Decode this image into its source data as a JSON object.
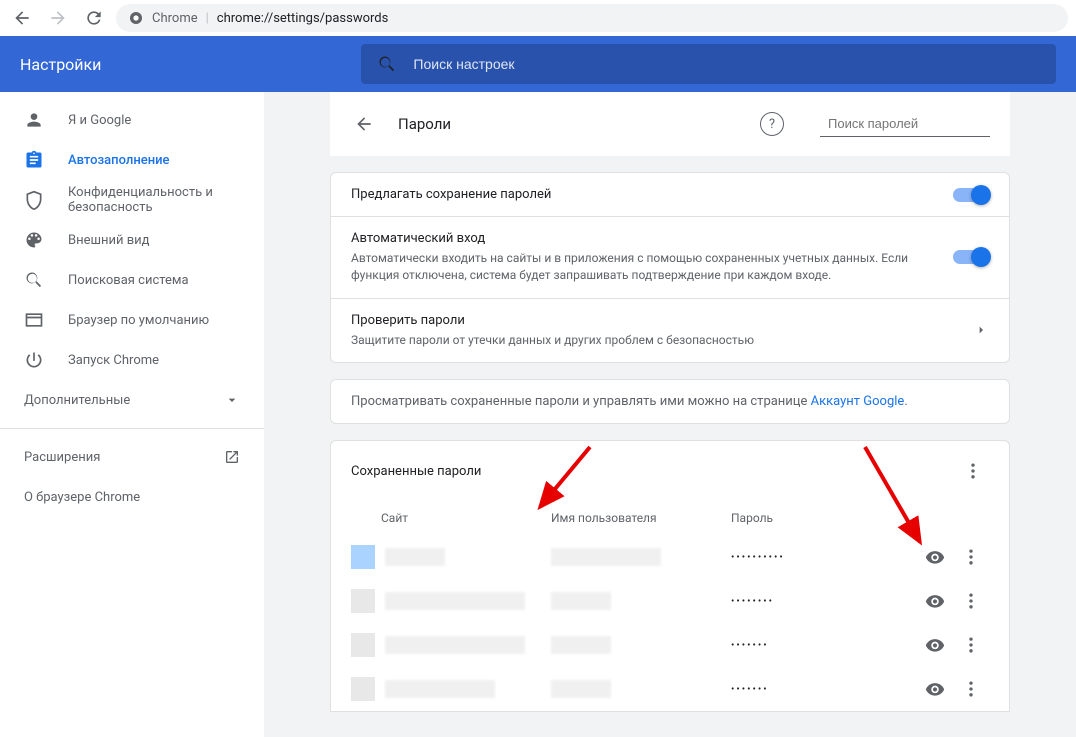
{
  "browser": {
    "addr_label": "Chrome",
    "url": "chrome://settings/passwords"
  },
  "header": {
    "title": "Настройки",
    "search_placeholder": "Поиск настроек"
  },
  "sidebar": {
    "items": [
      {
        "label": "Я и Google"
      },
      {
        "label": "Автозаполнение"
      },
      {
        "label": "Конфиденциальность и безопасность"
      },
      {
        "label": "Внешний вид"
      },
      {
        "label": "Поисковая система"
      },
      {
        "label": "Браузер по умолчанию"
      },
      {
        "label": "Запуск Chrome"
      }
    ],
    "more": "Дополнительные",
    "extensions": "Расширения",
    "about": "О браузере Chrome"
  },
  "page": {
    "title": "Пароли",
    "search_placeholder": "Поиск паролей"
  },
  "settings": {
    "offer_save": "Предлагать сохранение паролей",
    "auto_signin_title": "Автоматический вход",
    "auto_signin_desc": "Автоматически входить на сайты и в приложения с помощью сохраненных учетных данных. Если функция отключена, система будет запрашивать подтверждение при каждом входе.",
    "check_title": "Проверить пароли",
    "check_desc": "Защитите пароли от утечки данных и других проблем с безопасностью",
    "manage_text": "Просматривать сохраненные пароли и управлять ими можно на странице ",
    "manage_link": "Аккаунт Google"
  },
  "pw_table": {
    "title": "Сохраненные пароли",
    "col_site": "Сайт",
    "col_user": "Имя пользователя",
    "col_pass": "Пароль",
    "rows": [
      {
        "dots": "••••••••••"
      },
      {
        "dots": "••••••••"
      },
      {
        "dots": "•••••••"
      },
      {
        "dots": "•••••••"
      }
    ]
  }
}
